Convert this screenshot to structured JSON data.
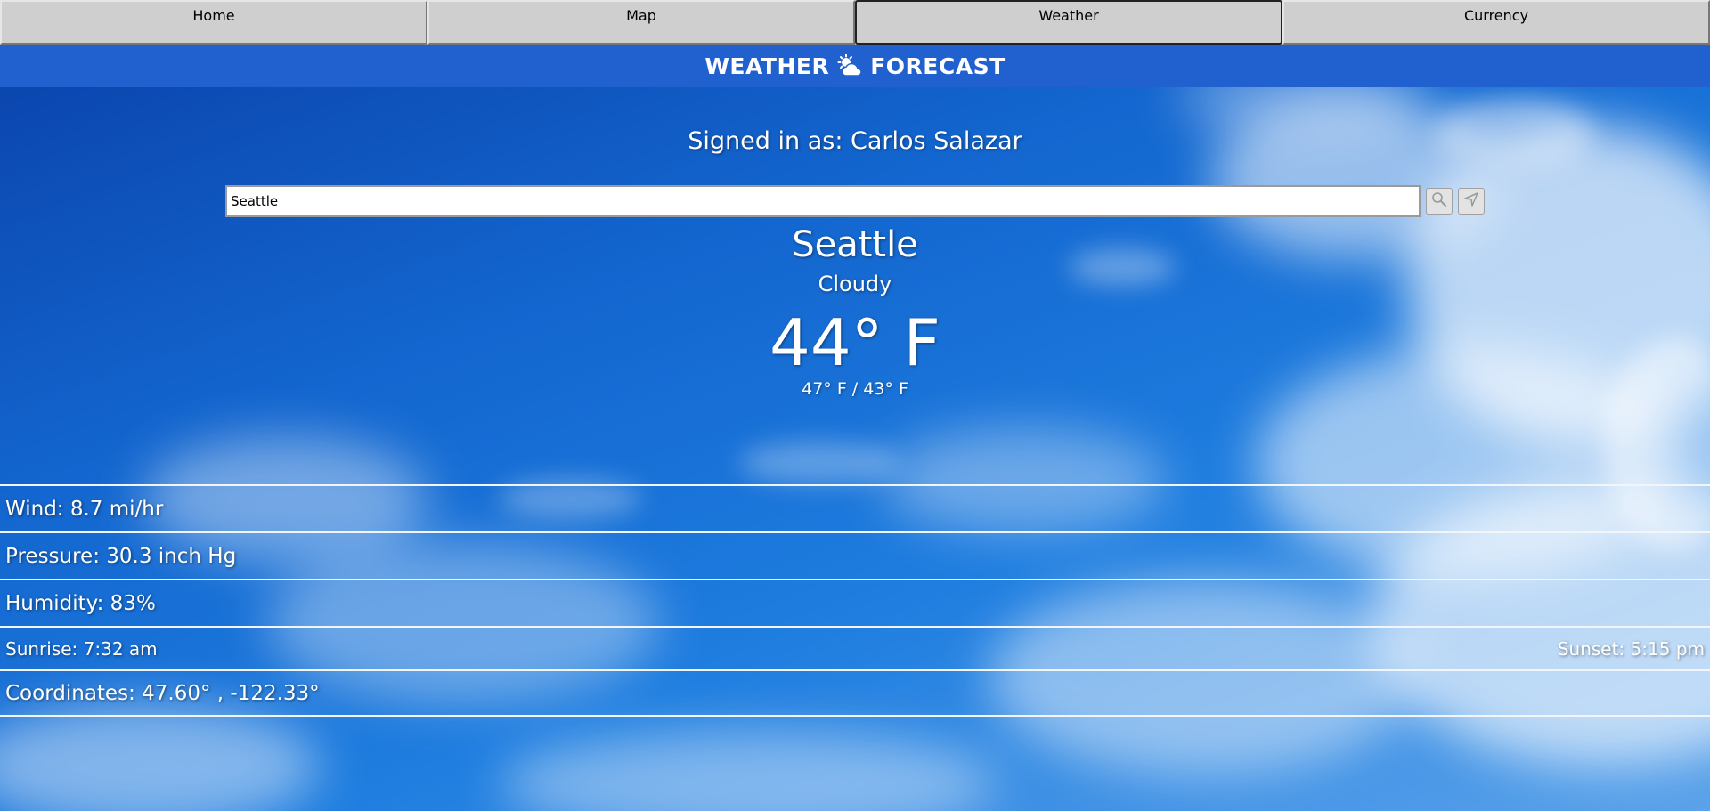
{
  "nav": {
    "tabs": [
      {
        "label": "Home"
      },
      {
        "label": "Map"
      },
      {
        "label": "Weather"
      },
      {
        "label": "Currency"
      }
    ]
  },
  "header": {
    "title_left": "WEATHER",
    "title_right": "FORECAST",
    "icon": "sun-cloud-icon",
    "color": "#2060cf"
  },
  "user": {
    "signed_in_text": "Signed in as: Carlos Salazar"
  },
  "search": {
    "value": "Seattle",
    "search_icon": "search-icon",
    "location_icon": "location-arrow-icon"
  },
  "weather": {
    "city": "Seattle",
    "condition": "Cloudy",
    "temperature": "44° F",
    "high_low": "47° F / 43° F"
  },
  "details": {
    "wind": "Wind: 8.7 mi/hr",
    "pressure": "Pressure: 30.3 inch Hg",
    "humidity": "Humidity: 83%",
    "sunrise": "Sunrise: 7:32 am",
    "sunset": "Sunset: 5:15 pm",
    "coordinates": "Coordinates: 47.60° , -122.33°"
  }
}
